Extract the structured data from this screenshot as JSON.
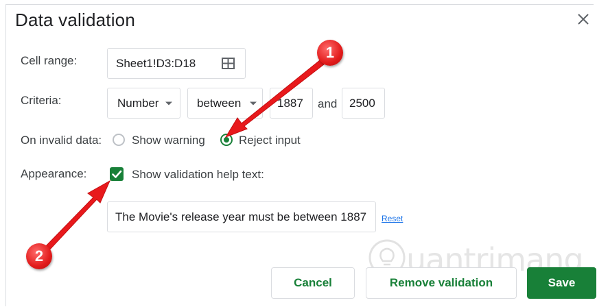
{
  "dialog": {
    "title": "Data validation",
    "close_icon": "close-icon"
  },
  "cell_range": {
    "label": "Cell range:",
    "value": "Sheet1!D3:D18",
    "icon": "grid-select-icon"
  },
  "criteria": {
    "label": "Criteria:",
    "type": "Number",
    "operator": "between",
    "min": "1887",
    "joiner": "and",
    "max": "2500"
  },
  "invalid_data": {
    "label": "On invalid data:",
    "options": [
      "Show warning",
      "Reject input"
    ],
    "selected": "Reject input"
  },
  "appearance": {
    "label": "Appearance:",
    "checkbox_label": "Show validation help text:",
    "checked": true,
    "help_text": "The Movie's release year must be between 1887",
    "reset_label": "Reset"
  },
  "buttons": {
    "cancel": "Cancel",
    "remove": "Remove validation",
    "save": "Save"
  },
  "annotations": [
    "1",
    "2"
  ],
  "watermark": "uantrimang",
  "colors": {
    "accent": "#188038",
    "marker": "#e21b1b",
    "link": "#1a73e8"
  }
}
